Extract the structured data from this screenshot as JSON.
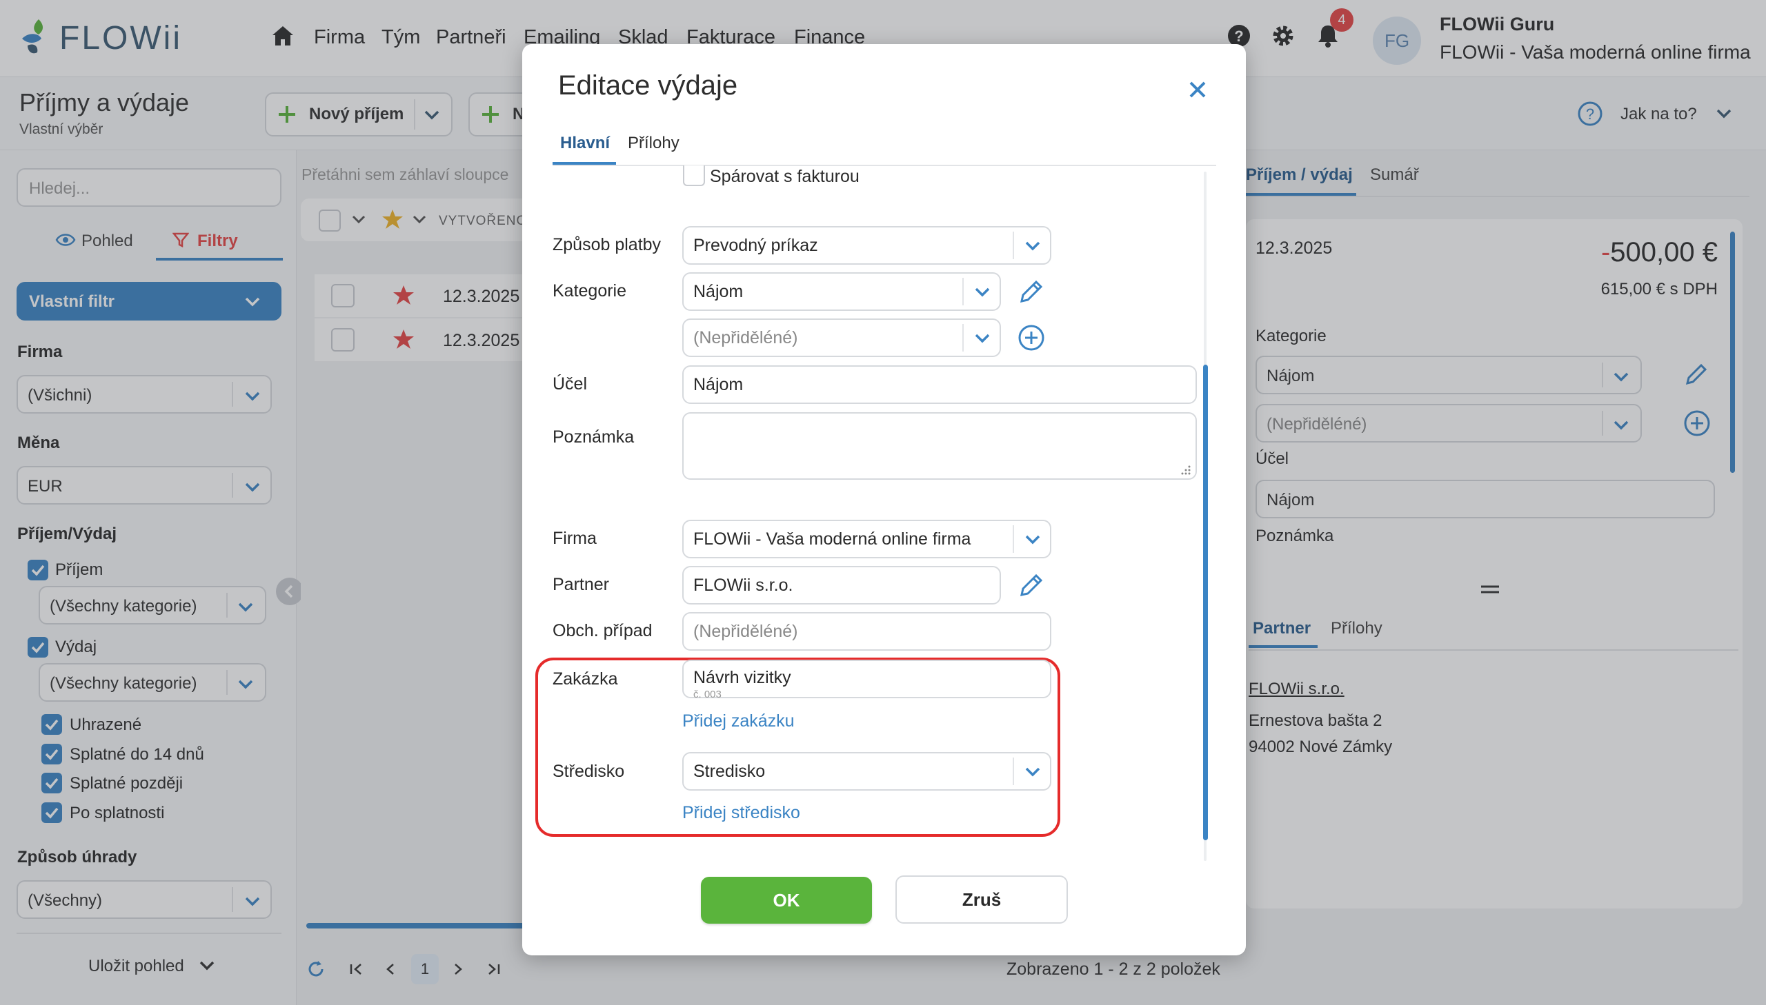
{
  "app": {
    "logo": "FLOWii",
    "nav": [
      "Firma",
      "Tým",
      "Partneři",
      "Emailing",
      "Sklad",
      "Fakturace",
      "Finance"
    ],
    "notifications_count": "4",
    "avatar_initials": "FG",
    "user_name": "FLOWii Guru",
    "company_tagline": "FLOWii - Vaša moderná online firma"
  },
  "page": {
    "title": "Příjmy a výdaje",
    "subtitle": "Vlastní výběr",
    "new_income_label": "Nový příjem",
    "new_other_label": "N",
    "help_label": "Jak na to?"
  },
  "sidebar": {
    "search_placeholder": "Hledej...",
    "tab_view": "Pohled",
    "tab_filters": "Filtry",
    "custom_filter": "Vlastní filtr",
    "firma_label": "Firma",
    "firma_value": "(Všichni)",
    "mena_label": "Měna",
    "mena_value": "EUR",
    "type_label": "Příjem/Výdaj",
    "income_label": "Příjem",
    "income_category": "(Všechny kategorie)",
    "expense_label": "Výdaj",
    "expense_category": "(Všechny kategorie)",
    "status_paid": "Uhrazené",
    "status_due14": "Splatné do 14 dnů",
    "status_later": "Splatné později",
    "status_overdue": "Po splatnosti",
    "payment_label": "Způsob úhrady",
    "payment_value": "(Všechny)",
    "save_view": "Uložit pohled"
  },
  "grid": {
    "drag_hint": "Přetáhni sem záhlaví sloupce",
    "col_created": "VYTVOŘENO",
    "rows": [
      {
        "date": "12.3.2025"
      },
      {
        "date": "12.3.2025"
      }
    ],
    "page": "1",
    "summary": "Zobrazeno 1 - 2 z 2 položek"
  },
  "detail": {
    "tab_main": "Příjem / výdaj",
    "tab_sum": "Sumář",
    "date": "12.3.2025",
    "amount_sign": "-",
    "amount": "500,00 €",
    "amount_vat": "615,00 € s DPH",
    "category_label": "Kategorie",
    "category_value": "Nájom",
    "subcategory_value": "(Nepřiděléné)",
    "purpose_label": "Účel",
    "purpose_value": "Nájom",
    "note_label": "Poznámka",
    "tab_partner": "Partner",
    "tab_attachments": "Přílohy",
    "partner_name": "FLOWii s.r.o.",
    "partner_street": "Ernestova bašta 2",
    "partner_city": "94002 Nové Zámky"
  },
  "modal": {
    "title": "Editace výdaje",
    "tab_main": "Hlavní",
    "tab_attachments": "Přílohy",
    "pair_invoice_label": "Spárovat s fakturou",
    "payment_method_label": "Způsob platby",
    "payment_method_value": "Prevodný príkaz",
    "category_label": "Kategorie",
    "category_value": "Nájom",
    "subcategory_placeholder": "(Nepřiděléné)",
    "purpose_label": "Účel",
    "purpose_value": "Nájom",
    "note_label": "Poznámka",
    "note_value": "",
    "company_label": "Firma",
    "company_value": "FLOWii - Vaša moderná online firma",
    "partner_label": "Partner",
    "partner_value": "FLOWii s.r.o.",
    "deal_label": "Obch. případ",
    "deal_placeholder": "(Nepřiděléné)",
    "order_label": "Zakázka",
    "order_value": "Návrh vizitky",
    "order_number": "č. 003",
    "add_order_link": "Přidej zakázku",
    "center_label": "Středisko",
    "center_value": "Stredisko",
    "add_center_link": "Přidej středisko",
    "ok_label": "OK",
    "cancel_label": "Zruš"
  },
  "colors": {
    "accent": "#3b84c4",
    "ok_green": "#5ab43c",
    "highlight_red": "#e52b2b",
    "amount_negative": "#e64545"
  }
}
